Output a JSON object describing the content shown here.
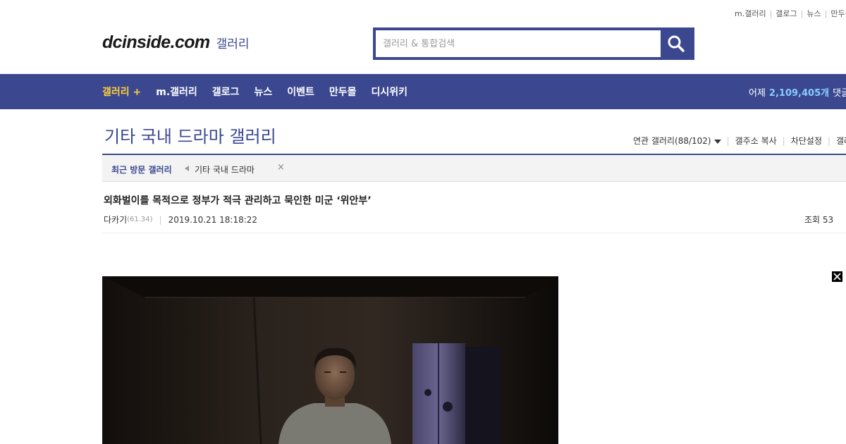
{
  "top_links": [
    "m.갤러리",
    "갤로그",
    "뉴스",
    "만두몰"
  ],
  "header": {
    "logo_main": "dcinside.com",
    "logo_sub": "갤러리",
    "search_placeholder": "갤러리 & 통합검색",
    "search_icon": "search-icon"
  },
  "nav": {
    "items": [
      "갤러리 +",
      "m.갤러리",
      "갤로그",
      "뉴스",
      "이벤트",
      "만두몰",
      "디시위키"
    ],
    "stat_label": "어제",
    "stat_value": "2,109,405개",
    "stat_suffix": "댓글"
  },
  "gallery": {
    "title": "기타 국내 드라마 갤러리",
    "tools": [
      "연관 갤러리(88/102)",
      "갤주소 복사",
      "차단설정",
      "갤러리"
    ]
  },
  "recent": {
    "label": "최근 방문 갤러리",
    "item": "기타 국내 드라마",
    "close": "×"
  },
  "post": {
    "title": "외화벌이를 목적으로 정부가 적극 관리하고 묵인한 미군 ‘위안부’",
    "author": "다카기",
    "ip": "(61.34)",
    "date": "2019.10.21 18:18:22",
    "views": "조회 53"
  },
  "colors": {
    "brand": "#3b4890",
    "nav_active": "#ffd03a",
    "stat_number": "#88ccff"
  }
}
